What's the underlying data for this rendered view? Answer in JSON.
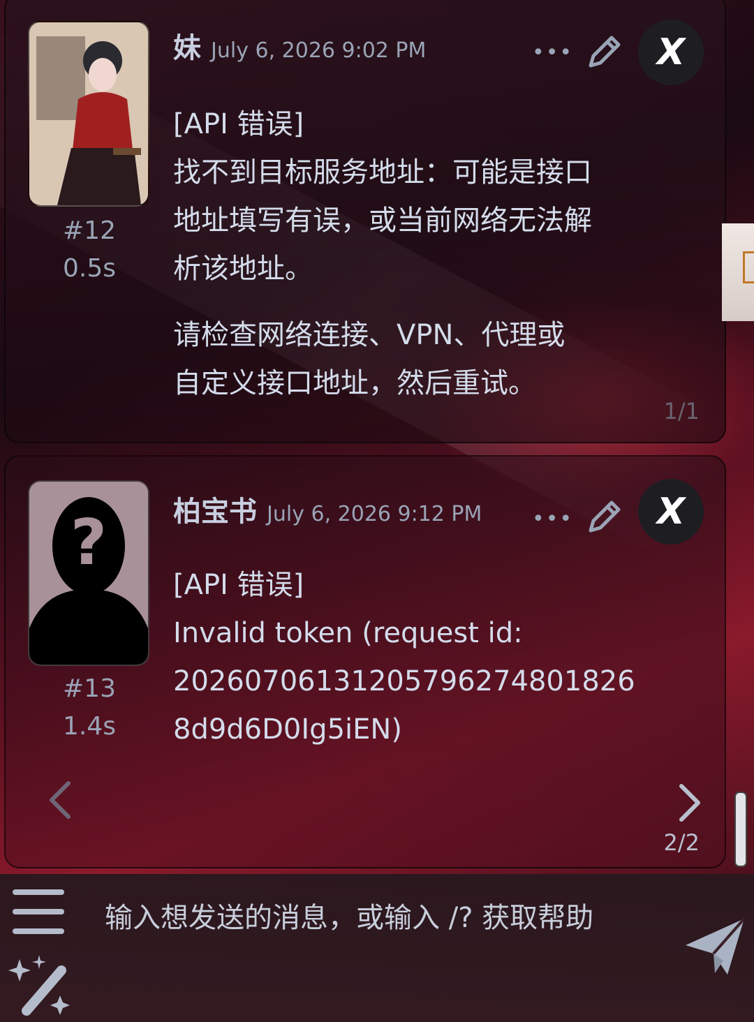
{
  "messages": [
    {
      "name": "妹",
      "timestamp": "July 6, 2026 9:02 PM",
      "number": "#12",
      "duration": "0.5s",
      "paragraphs": [
        [
          "[API 错误]",
          "找不到目标服务地址：可能是接口",
          "地址填写有误，或当前网络无法解",
          "析该地址。"
        ],
        [
          "请检查网络连接、VPN、代理或",
          "自定义接口地址，然后重试。"
        ]
      ],
      "swipe_counter": "1/1"
    },
    {
      "name": "柏宝书",
      "timestamp": "July 6, 2026 9:12 PM",
      "number": "#13",
      "duration": "1.4s",
      "paragraphs": [
        [
          "[API 错误]",
          "Invalid token (request id:",
          "2026070613120579627480182​6",
          "8d9d6D0Ig5iEN)"
        ]
      ],
      "swipe_counter": "2/2"
    }
  ],
  "message_actions": {
    "more_glyph": "•••",
    "close_glyph": "X"
  },
  "composer": {
    "placeholder": "输入想发送的消息，或输入 /? 获取帮助"
  },
  "colors": {
    "text": "#d4dceb",
    "meta": "#9aa4b6",
    "accent_red": "#8a1a2c"
  }
}
